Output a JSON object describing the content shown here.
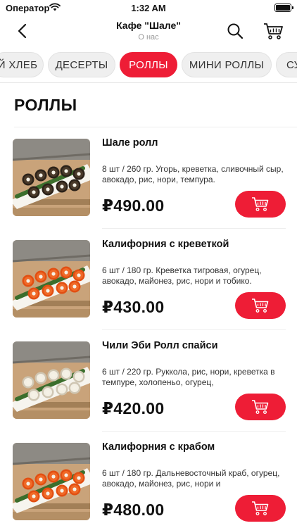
{
  "status_bar": {
    "carrier": "Оператор",
    "time": "1:32 AM"
  },
  "nav": {
    "title": "Кафе \"Шале\"",
    "subtitle": "О нас",
    "back_icon": "chevron-left-icon",
    "search_icon": "search-icon",
    "cart_icon": "cart-icon"
  },
  "tabs": [
    {
      "label": "Й ХЛЕБ",
      "active": false
    },
    {
      "label": "ДЕСЕРТЫ",
      "active": false
    },
    {
      "label": "РОЛЛЫ",
      "active": true
    },
    {
      "label": "МИНИ РОЛЛЫ",
      "active": false
    },
    {
      "label": "СУ",
      "active": false
    }
  ],
  "section": {
    "title": "РОЛЛЫ"
  },
  "items": [
    {
      "name": "Шале ролл",
      "description": "8 шт / 260 гр.  Угорь, креветка, сливочный сыр, авокадо, рис, нори, темпура.",
      "price": "₽490.00",
      "roll_color": "dark"
    },
    {
      "name": "Калифорния с креветкой",
      "description": "6 шт / 180 гр. Креветка тигровая, огурец, авокадо, майонез, рис, нори и тобико.",
      "price": "₽430.00",
      "roll_color": "orange"
    },
    {
      "name": "Чили Эби Ролл спайси",
      "description": "6 шт / 220 гр.  Руккола, рис, нори, креветка в темпуре, холопеньо, огурец,",
      "price": "₽420.00",
      "roll_color": "white"
    },
    {
      "name": "Калифорния с крабом",
      "description": "6 шт / 180 гр. Дальневосточный краб, огурец, авокадо, майонез, рис, нори и",
      "price": "₽480.00",
      "roll_color": "orange"
    }
  ],
  "colors": {
    "accent": "#ee1d36",
    "wood": "#b08a5f",
    "plate": "#f4f1ea"
  }
}
